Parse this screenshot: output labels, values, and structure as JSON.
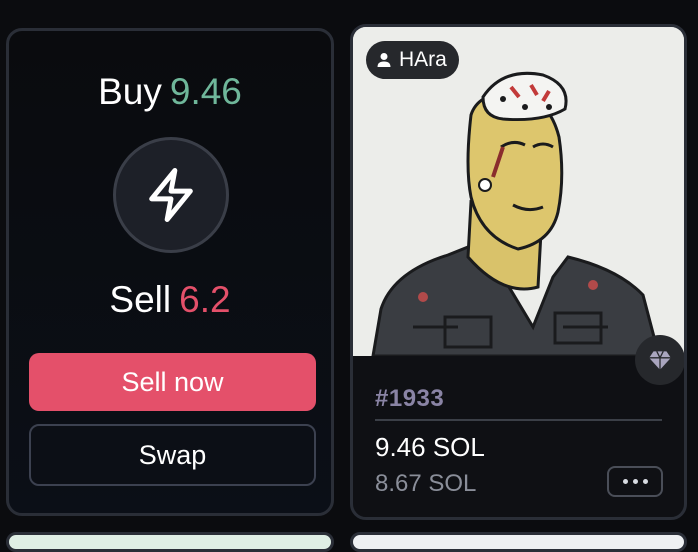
{
  "trade_card": {
    "buy_label": "Buy",
    "buy_value": "9.46",
    "sell_label": "Sell",
    "sell_value": "6.2",
    "sell_button_label": "Sell now",
    "swap_button_label": "Swap",
    "icon": "lightning-bolt-icon",
    "colors": {
      "buy": "#6fb79a",
      "sell": "#e4506a"
    }
  },
  "nft_card": {
    "owner": "HAra",
    "owner_icon": "user-icon",
    "token_id": "#1933",
    "price": "9.46 SOL",
    "last_price": "8.67 SOL",
    "rarity_icon": "gem-icon",
    "more_icon": "more-horizontal-icon"
  }
}
